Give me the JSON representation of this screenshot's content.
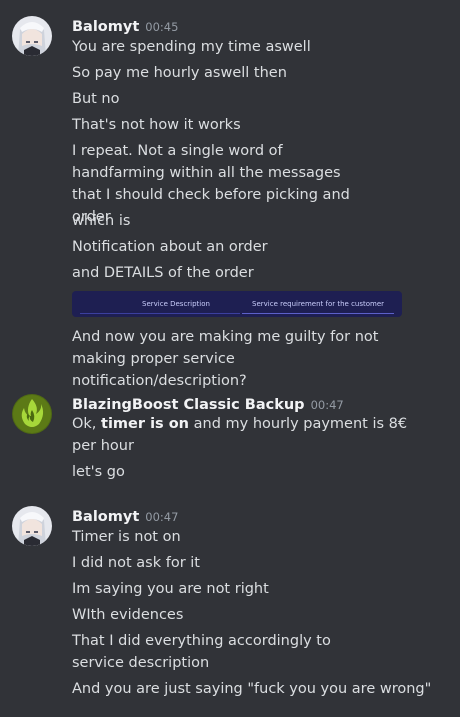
{
  "messages": [
    {
      "author": "Balomyt",
      "time": "00:45",
      "lines": [
        "You are spending my time aswell",
        "So pay me hourly aswell then",
        "But no",
        "That's not how it works",
        "I repeat. Not a single word of handfarming within all the messages that I should check before picking and order",
        "which is",
        "Notification about an order",
        "and DETAILS of the order"
      ],
      "embed": {
        "tab1": "Service Description",
        "tab2": "Service requirement for the customer"
      },
      "after_embed": "And now you are making me guilty for not making proper service notification/description?"
    },
    {
      "author": "BlazingBoost Classic Backup",
      "time": "00:47",
      "line1_prefix": "Ok, ",
      "line1_bold": "timer is on",
      "line1_suffix": " and my hourly payment is 8€ per hour",
      "line2": "let's go"
    },
    {
      "author": "Balomyt",
      "time": "00:47",
      "lines": [
        "Timer is not on",
        "I did not ask for it",
        "Im saying you are not right",
        "WIth evidences",
        "That I did everything accordingly to service description",
        "And you are just saying \"fuck you you are wrong\""
      ]
    }
  ],
  "colors": {
    "background": "#313338",
    "username": "#f2f3f5",
    "text": "#dbdee1",
    "timestamp": "#949ba4",
    "embed_bg": "#1e1f52"
  },
  "icons": {
    "balomyt_avatar": "anime-avatar-white-hair",
    "blazing_avatar": "green-flame-logo"
  }
}
